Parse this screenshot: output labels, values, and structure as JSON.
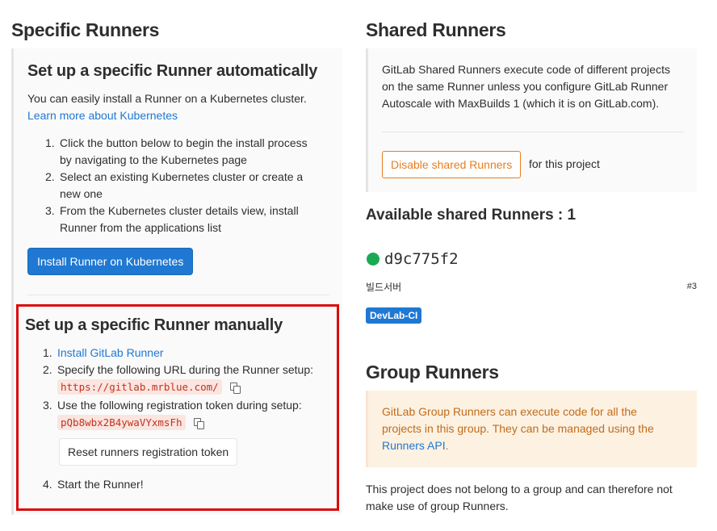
{
  "specific": {
    "heading": "Specific Runners",
    "auto": {
      "title": "Set up a specific Runner automatically",
      "intro": "You can easily install a Runner on a Kubernetes cluster.",
      "learn_link": "Learn more about Kubernetes",
      "steps": [
        {
          "num": "1.",
          "lines": [
            "Click the button below to begin the install process",
            "by navigating to the Kubernetes page"
          ]
        },
        {
          "num": "2.",
          "lines": [
            "Select an existing Kubernetes cluster or create a",
            "new one"
          ]
        },
        {
          "num": "3.",
          "lines": [
            "From the Kubernetes cluster details view, install",
            "Runner from the applications list"
          ]
        }
      ],
      "install_button": "Install Runner on Kubernetes"
    },
    "manual": {
      "title": "Set up a specific Runner manually",
      "step1_num": "1.",
      "step1_link": "Install GitLab Runner",
      "step2_num": "2.",
      "step2_text": "Specify the following URL during the Runner setup:",
      "url": "https://gitlab.mrblue.com/",
      "step3_num": "3.",
      "step3_text": "Use the following registration token during setup:",
      "token": "pQb8wbx2B4ywaVYxmsFh",
      "reset_button": "Reset runners registration token",
      "step4_num": "4.",
      "step4_text": "Start the Runner!"
    }
  },
  "shared": {
    "heading": "Shared Runners",
    "desc_lines": [
      "GitLab Shared Runners execute code of different projects",
      "on the same Runner unless you configure GitLab Runner",
      "Autoscale with MaxBuilds 1 (which it is on GitLab.com)."
    ],
    "disable_button": "Disable shared Runners",
    "for_project": "for this project",
    "available_title": "Available shared Runners : 1",
    "runner": {
      "id": "d9c775f2",
      "description": "빌드서버",
      "number": "#3",
      "tag": "DevLab-CI",
      "status_color": "#1aaa55"
    }
  },
  "group": {
    "heading": "Group Runners",
    "info_line1": "GitLab Group Runners can execute code for all the",
    "info_line2": "projects in this group. They can be managed using the",
    "info_link": "Runners API",
    "info_end": ".",
    "note_lines": [
      "This project does not belong to a group and can therefore not",
      "make use of group Runners."
    ]
  },
  "colors": {
    "primary": "#1f78d1",
    "warning": "#e67e22",
    "highlight_border": "#db0b0b"
  }
}
